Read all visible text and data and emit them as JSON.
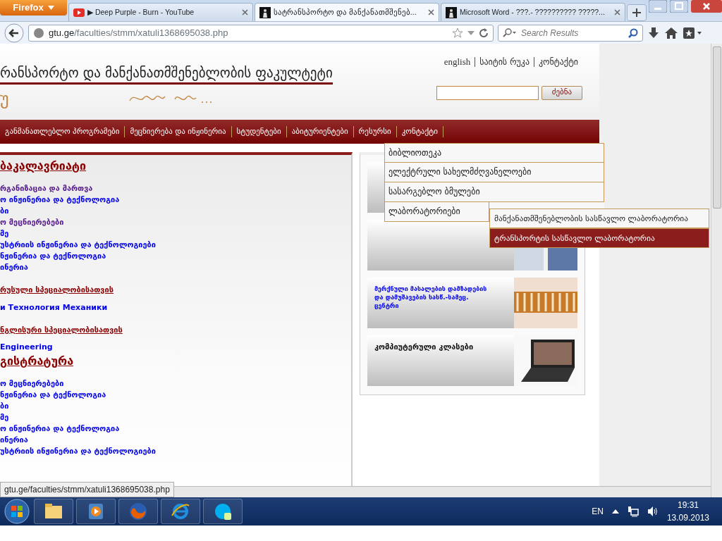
{
  "browser": {
    "menu_button": "Firefox",
    "tabs": [
      {
        "title": "▶ Deep Purple - Burn - YouTube",
        "kind": "video",
        "selected": false
      },
      {
        "title": "სატრანსპორტო და მანქანათმშენებ...",
        "kind": "site",
        "selected": true
      },
      {
        "title": "Microsoft Word - ???.- ?????????? ?????...",
        "kind": "site",
        "selected": false
      }
    ],
    "url_host": "gtu.ge",
    "url_path": "/faculties/stmm/xatuli1368695038.php",
    "search": {
      "placeholder": "Search Results"
    }
  },
  "header": {
    "title": "რანსპორტო და მანქანათმშენებლობის ფაკულტეტი",
    "logo_text": "უ",
    "top_links": [
      "english",
      "საიტის რუკა",
      "კონტაქტი"
    ],
    "search_button": "ძებნა"
  },
  "nav": [
    "განმანათლებლო პროგრამები",
    "მეცნიერება და ინჟინერია",
    "სტუდენტები",
    "აბიტურიენტები",
    "რესურსი",
    "კონტაქტი"
  ],
  "dropdown": {
    "items": [
      "ბიბლიოთეკა",
      "ელექტრული სახელმძღვანელოები",
      "სასარგებლო ბმულები",
      "ლაბორატორიები"
    ],
    "submenu": [
      {
        "label": "მანქანათმშენებლობის სასწავლო ლაბორატორია",
        "selected": false
      },
      {
        "label": "ტრანსპორტის სასწავლო ლაბორატორია",
        "selected": true
      }
    ]
  },
  "sections": [
    {
      "heading": "ბაკალავრიატი",
      "kind": "major",
      "items": [
        {
          "label": "რგანიზაცია და მართვა",
          "visited": true
        },
        {
          "label": "ო ინჟინერია და ტექნოლოგია",
          "visited": false
        },
        {
          "label": "ბი",
          "visited": false
        },
        {
          "label": "ო მეცნიერებები",
          "visited": true
        },
        {
          "label": "მე",
          "visited": false
        },
        {
          "label": "უსტრიის ინჟინერია და ტექნოლოგიები",
          "visited": false
        },
        {
          "label": "ნჟინერია და ტექნოლოგია",
          "visited": false
        },
        {
          "label": "ინერია",
          "visited": false
        }
      ]
    },
    {
      "heading": "რუსული სპეციალობისათვის",
      "kind": "minor",
      "items": [
        {
          "label": "и Технология Механики",
          "visited": false
        }
      ]
    },
    {
      "heading": "ნგლისური სპეციალობისათვის",
      "kind": "minor",
      "items": [
        {
          "label": "Engineering",
          "visited": false
        }
      ]
    },
    {
      "heading": "გისტრატურა",
      "kind": "major",
      "items": [
        {
          "label": "ო მეცნიერებები",
          "visited": false
        },
        {
          "label": "ნჟინერია და ტექნოლოგია",
          "visited": false
        },
        {
          "label": "ბი",
          "visited": false
        },
        {
          "label": "მე",
          "visited": false
        },
        {
          "label": "ო ინჟინერია და ტექნოლოგია",
          "visited": false
        },
        {
          "label": "ინერია",
          "visited": false
        },
        {
          "label": "უსტრიის ინჟინერია და ტექნოლოგიები",
          "visited": false
        }
      ]
    }
  ],
  "banners": [
    {
      "kind": "plain"
    },
    {
      "kind": "clothes"
    },
    {
      "kind": "wood",
      "title": "მერქნული მასალების დამზადების და დამუშავების სასწ.-სამეც. ცენტრი"
    },
    {
      "kind": "laptop",
      "title": "კომპიუტერული კლასები"
    }
  ],
  "status_url": "gtu.ge/faculties/stmm/xatuli1368695038.php",
  "taskbar": {
    "language": "EN",
    "time": "19:31",
    "date": "13.09.2013"
  }
}
